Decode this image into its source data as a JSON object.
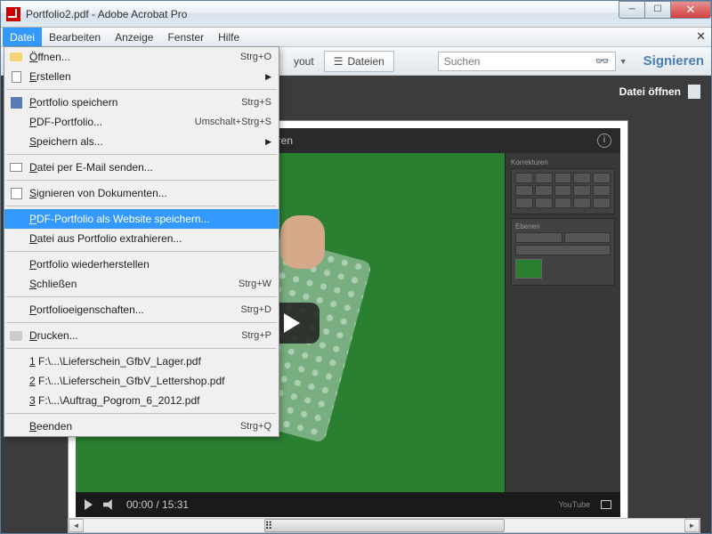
{
  "window": {
    "title": "Portfolio2.pdf - Adobe Acrobat Pro"
  },
  "menubar": {
    "items": [
      "Datei",
      "Bearbeiten",
      "Anzeige",
      "Fenster",
      "Hilfe"
    ]
  },
  "toolbar": {
    "layout_label": "yout",
    "dateien_label": "Dateien",
    "search_placeholder": "Suchen",
    "sign_label": "Signieren"
  },
  "content": {
    "datei_offnen": "Datei öffnen",
    "video_header_text": "fahren",
    "video_time_current": "00:00",
    "video_time_total": "15:31",
    "youtube_label": "YouTube"
  },
  "dropdown": {
    "items": [
      {
        "label": "Öffnen...",
        "shortcut": "Strg+O",
        "icon": "folder"
      },
      {
        "label": "Erstellen",
        "submenu": true,
        "icon": "doc"
      },
      {
        "sep": true
      },
      {
        "label": "Portfolio speichern",
        "shortcut": "Strg+S",
        "icon": "save"
      },
      {
        "label": "PDF-Portfolio...",
        "shortcut": "Umschalt+Strg+S"
      },
      {
        "label": "Speichern als...",
        "submenu": true
      },
      {
        "sep": true
      },
      {
        "label": "Datei per E-Mail senden...",
        "icon": "mail"
      },
      {
        "sep": true
      },
      {
        "label": "Signieren von Dokumenten...",
        "icon": "sign"
      },
      {
        "sep": true
      },
      {
        "label": "PDF-Portfolio als Website speichern...",
        "highlighted": true
      },
      {
        "label": "Datei aus Portfolio extrahieren..."
      },
      {
        "sep": true
      },
      {
        "label": "Portfolio wiederherstellen"
      },
      {
        "label": "Schließen",
        "shortcut": "Strg+W"
      },
      {
        "sep": true
      },
      {
        "label": "Portfolioeigenschaften...",
        "shortcut": "Strg+D"
      },
      {
        "sep": true
      },
      {
        "label": "Drucken...",
        "shortcut": "Strg+P",
        "icon": "print"
      },
      {
        "sep": true
      },
      {
        "label": "1 F:\\...\\Lieferschein_GfbV_Lager.pdf",
        "recent": true
      },
      {
        "label": "2 F:\\...\\Lieferschein_GfbV_Lettershop.pdf",
        "recent": true
      },
      {
        "label": "3 F:\\...\\Auftrag_Pogrom_6_2012.pdf",
        "recent": true
      },
      {
        "sep": true
      },
      {
        "label": "Beenden",
        "shortcut": "Strg+Q"
      }
    ]
  }
}
